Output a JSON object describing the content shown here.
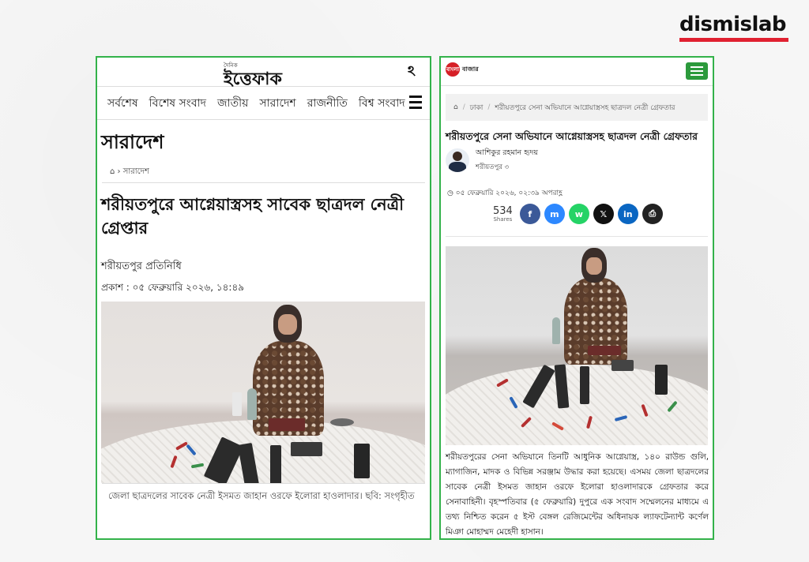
{
  "brand": {
    "name": "dismislab",
    "accent_color": "#e02131"
  },
  "left_article": {
    "site_logo": {
      "top_text": "দৈনিক",
      "name": "ইত্তেফাক"
    },
    "menu_icon": "ittefaq-menu-icon",
    "nav_items": [
      "সর্বশেষ",
      "বিশেষ সংবাদ",
      "জাতীয়",
      "সারাদেশ",
      "রাজনীতি",
      "বিশ্ব সংবাদ"
    ],
    "section_title": "সারাদেশ",
    "breadcrumb": {
      "home_icon": "home-icon",
      "separator": "›",
      "section": "সারাদেশ"
    },
    "headline": "শরীয়তপুরে আগ্নেয়াস্ত্রসহ সাবেক ছাত্রদল নেত্রী গ্রেপ্তার",
    "byline": "শরীয়তপুর প্রতিনিধি",
    "published": "প্রকাশ : ০৫ ফেব্রুয়ারি ২০২৬, ১৪:৪৯",
    "photo_caption": "জেলা ছাত্রদলের সাবেক নেত্রী ইসমত জাহান ওরফে ইলোরা হাওলাদার। ছবি: সংগৃহীত"
  },
  "right_article": {
    "site_logo": {
      "badge": "বাংলা",
      "name": "বাজার"
    },
    "breadcrumb": {
      "home_icon": "home-icon",
      "separator": "/",
      "section": "ঢাকা",
      "current": "শরীয়তপুরে সেনা অভিযানে আগ্নেয়াস্ত্রসহ ছাত্রদল নেত্রী গ্রেফতার"
    },
    "headline": "শরীয়তপুরে সেনা অভিযানে আগ্নেয়াস্ত্রসহ ছাত্রদল নেত্রী গ্রেফতার",
    "author": {
      "name": "আশিকুর রহমান হৃদয়",
      "location": "শরীয়তপুর ৩"
    },
    "date": "০৫ ফেব্রুয়ারি ২০২৬, ০২:৩৯ অপরাহ্ণ",
    "shares": {
      "count": "534",
      "label": "Shares"
    },
    "share_buttons": [
      {
        "name": "facebook",
        "glyph": "f",
        "color": "#3b5998"
      },
      {
        "name": "messenger",
        "glyph": "m",
        "color": "#2d88ff"
      },
      {
        "name": "whatsapp",
        "glyph": "w",
        "color": "#25d366"
      },
      {
        "name": "x",
        "glyph": "𝕏",
        "color": "#111111"
      },
      {
        "name": "linkedin",
        "glyph": "in",
        "color": "#0a66c2"
      },
      {
        "name": "print",
        "glyph": "⎙",
        "color": "#222222"
      }
    ],
    "body": "শরীয়তপুরের সেনা অভিযানে তিনটি আধুনিক আগ্নেয়াস্ত্র, ১৪০ রাউন্ড গুলি, ম্যাগাজিন, মাদক ও বিভিন্ন সরঞ্জাম উদ্ধার করা হয়েছে। এসময় জেলা ছাত্রদলের সাবেক নেত্রী ইসমত জাহান ওরফে ইলোরা হাওলাদারকে গ্রেফতার করে সেনাবাহিনী। বৃহস্পতিবার (৫ ফেব্রুয়ারি) দুপুরে এক সংবাদ সম্মেলনের মাধ্যমে এ তথ্য নিশ্চিত করেন ৫ ইস্ট বেঙ্গল রেজিমেন্টের অধিনায়ক ল্যাফটেন্যান্ট কর্ণেল মিঞা মোহাম্মদ মেহেদী হাসান।"
  },
  "colors": {
    "panel_border": "#33b24a",
    "menu_button": "#2c9a3c"
  }
}
